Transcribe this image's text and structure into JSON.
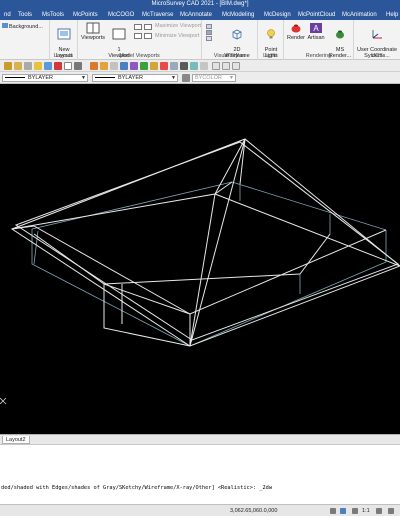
{
  "title": "MicroSurvey CAD 2021 - [BIM.dwg*]",
  "menu": [
    "nd",
    "Tools",
    "MsTools",
    "McPoints",
    "McCOGO",
    "McTraverse",
    "McAnnotate",
    "McModeling",
    "McDesign",
    "McPointCloud",
    "McAnimation",
    "Help"
  ],
  "ribbon": {
    "background_btn": "Background...",
    "new_layout": "New\nLayout",
    "layouts_label": "Layouts",
    "viewports_btn": "Viewports",
    "one_viewport": "1\nViewport",
    "model_viewports_label": "Model Viewports",
    "maximize_viewport": "Maximize Viewport",
    "minimize_viewport": "Minimize Viewport",
    "wireframe_btn": "2D\nWireframe",
    "visual_styles_label": "Visual Styles",
    "point_light_btn": "Point\nLight",
    "lights_label": "Lights",
    "render_btn": "Render",
    "artisan_btn": "Artisan",
    "ms_render_btn": "MS\nRender...",
    "rendering_label": "Rendering",
    "ucs_btn": "User Coordinate\nSystems...",
    "ucs_label": "UCS"
  },
  "layers": {
    "linetype": "BYLAYER",
    "lineweight": "BYLAYER",
    "color": "BYCOLOR"
  },
  "tabs": [
    "Layout2"
  ],
  "command": {
    "text": "ded/shaded with Edges/shades of Gray/SKetchy/Wireframe/X-ray/Other] <Realistic>: _2dw"
  },
  "status": {
    "coords": "3,062.65,060.0,000",
    "scale": "1:1"
  },
  "colors": {
    "title_bg": "#2b579a",
    "viewport_bg": "#000000",
    "wire": "#e8e8e8",
    "base_edge": "#7fa8b8"
  }
}
